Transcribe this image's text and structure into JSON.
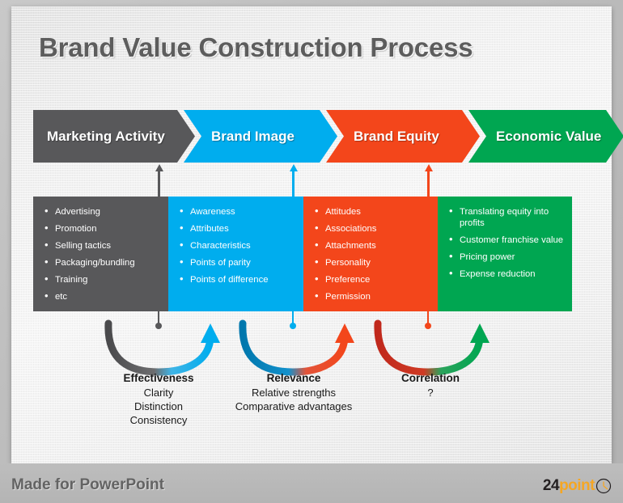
{
  "slide": {
    "title": "Brand Value Construction Process"
  },
  "colors": {
    "stage_gray": "#58585a",
    "stage_blue": "#00ADEE",
    "stage_red": "#F3461B",
    "stage_green": "#00A651",
    "title_text": "#5d5d5d",
    "footer_text": "#636363",
    "logo_orange": "#F5A623",
    "logo_dark": "#231f20"
  },
  "stages": [
    {
      "label": "Marketing Activity",
      "color": "#58585a",
      "items": [
        "Advertising",
        "Promotion",
        "Selling tactics",
        "Packaging/bundling",
        "Training",
        " etc"
      ]
    },
    {
      "label": "Brand Image",
      "color": "#00ADEE",
      "items": [
        "Awareness",
        "Attributes",
        "Characteristics",
        "Points of parity",
        "Points of difference"
      ]
    },
    {
      "label": "Brand Equity",
      "color": "#F3461B",
      "items": [
        "Attitudes",
        "Associations",
        "Attachments",
        "Personality",
        "Preference",
        "Permission"
      ]
    },
    {
      "label": "Economic Value",
      "color": "#00A651",
      "items": [
        "Translating equity into profits",
        "Customer franchise value",
        "Pricing power",
        "Expense reduction"
      ]
    }
  ],
  "links": [
    {
      "heading": "Effectiveness",
      "sublines": [
        "Clarity",
        "Distinction",
        "Consistency"
      ],
      "from_color": "#58585a",
      "to_color": "#00ADEE"
    },
    {
      "heading": "Relevance",
      "sublines": [
        "Relative strengths",
        "Comparative advantages"
      ],
      "from_color": "#0077AD",
      "to_color": "#F3461B"
    },
    {
      "heading": "Correlation",
      "sublines": [
        "?"
      ],
      "from_color": "#C0281C",
      "to_color": "#00A651"
    }
  ],
  "footer": {
    "text": "Made for PowerPoint",
    "logo_number": "24",
    "logo_word": "point",
    "logo_icon": "clock-icon"
  }
}
